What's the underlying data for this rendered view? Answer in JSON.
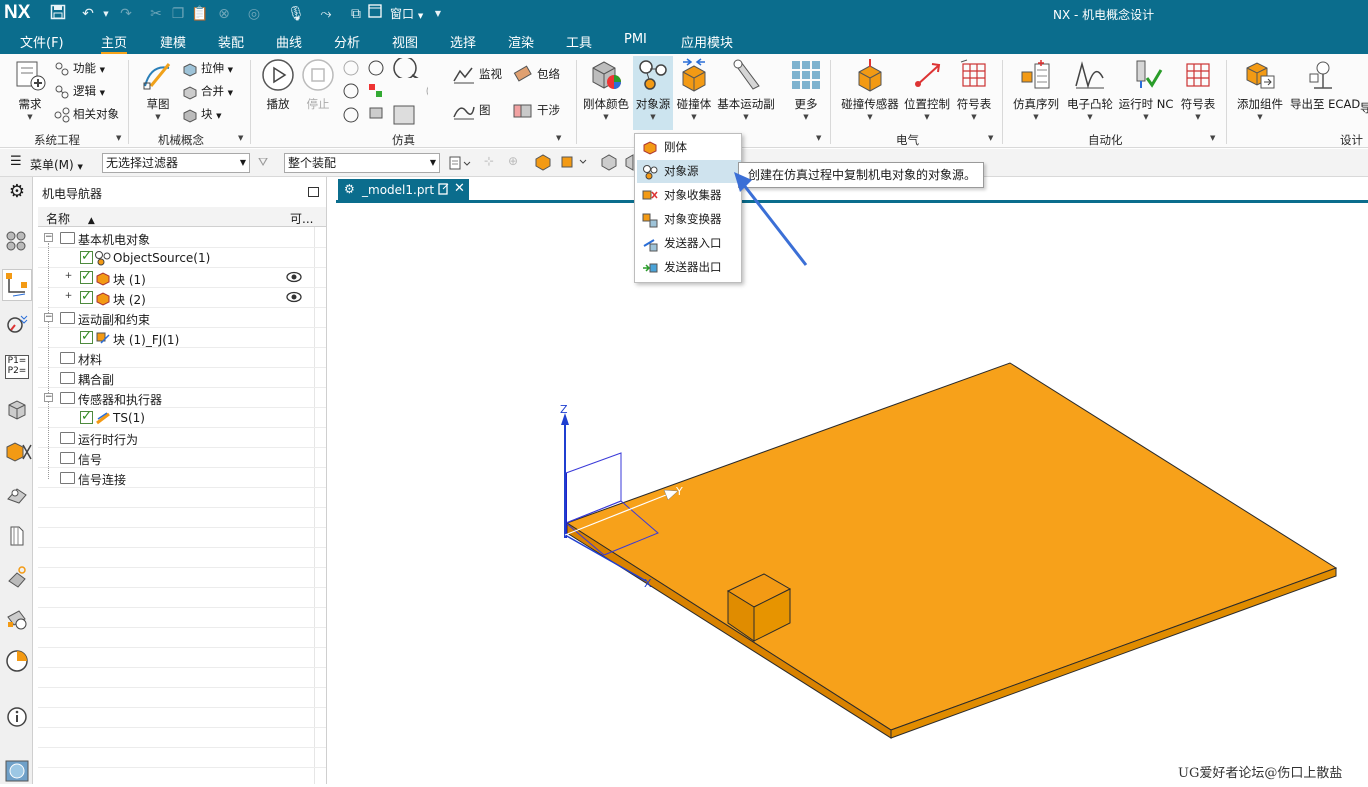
{
  "app": {
    "logo": "NX",
    "title": "NX - 机电概念设计",
    "window_menu": "窗口"
  },
  "menu": {
    "tabs": [
      "文件(F)",
      "主页",
      "建模",
      "装配",
      "曲线",
      "分析",
      "视图",
      "选择",
      "渲染",
      "工具",
      "PMI",
      "应用模块"
    ],
    "active": "主页"
  },
  "ribbon": {
    "system": {
      "group": "系统工程",
      "big": "需求",
      "small": [
        "功能",
        "逻辑",
        "相关对象"
      ]
    },
    "mechanical": {
      "group": "机械概念",
      "big": "草图",
      "small": [
        "拉伸",
        "合并",
        "块"
      ]
    },
    "simulation": {
      "group": "仿真",
      "play": "播放",
      "stop": "停止",
      "small": [
        "监视",
        "包络",
        "图",
        "干涉"
      ]
    },
    "physics": {
      "buttons": [
        "刚体颜色",
        "对象源",
        "碰撞体",
        "基本运动副",
        "更多"
      ]
    },
    "electrical": {
      "group": "电气",
      "buttons": [
        "碰撞传感器",
        "位置控制",
        "符号表"
      ]
    },
    "automation": {
      "group": "自动化",
      "buttons": [
        "仿真序列",
        "电子凸轮",
        "运行时 NC",
        "符号表"
      ]
    },
    "design": {
      "group": "设计协",
      "buttons": [
        "添加组件",
        "导出至 ECAD"
      ],
      "cut": "导"
    }
  },
  "toolbar": {
    "menu_label": "菜单(M)",
    "filter": "无选择过滤器",
    "assembly": "整个装配"
  },
  "navigator": {
    "title": "机电导航器",
    "col_name": "名称",
    "col_visible": "可...",
    "items": {
      "basic": "基本机电对象",
      "object_source": "ObjectSource(1)",
      "block1": "块 (1)",
      "block2": "块 (2)",
      "joints": "运动副和约束",
      "fj": "块 (1)_FJ(1)",
      "material": "材料",
      "coupler": "耦合副",
      "sensors": "传感器和执行器",
      "ts": "TS(1)",
      "runtime": "运行时行为",
      "signal": "信号",
      "signal_conn": "信号连接"
    }
  },
  "document": {
    "tab": "_model1.prt"
  },
  "dropdown": {
    "items": [
      "刚体",
      "对象源",
      "对象收集器",
      "对象变换器",
      "发送器入口",
      "发送器出口"
    ],
    "hovered": "对象源",
    "tooltip": "创建在仿真过程中复制机电对象的对象源。"
  },
  "viewport": {
    "axis_z": "Z",
    "axis_y": "Y",
    "axis_x": "X",
    "plate_color": "#f7a11a",
    "block_color": "#f39a14"
  },
  "watermark": "UG爱好者论坛@伤口上散盐",
  "colors": {
    "titlebar": "#0b6d8d",
    "accent": "#f6a21a",
    "hover": "#cfe3ee"
  }
}
